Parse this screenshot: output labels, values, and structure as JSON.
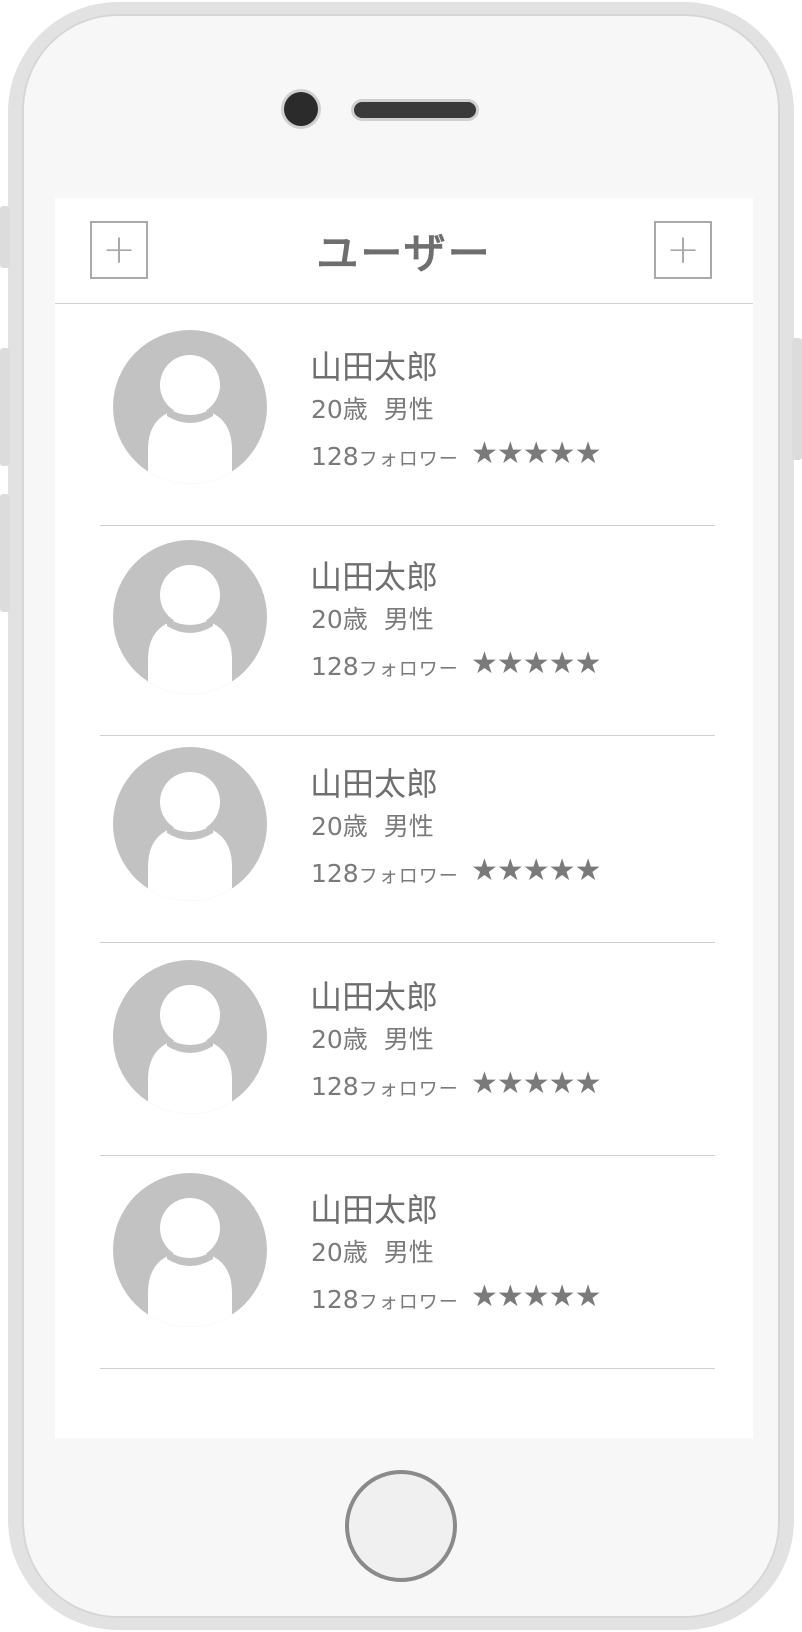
{
  "nav": {
    "title": "ユーザー",
    "left_button_label": "+",
    "right_button_label": "+"
  },
  "users": [
    {
      "name": "山田太郎",
      "meta": "20歳  男性",
      "followers_count": "128",
      "followers_label": "フォロワー",
      "stars": "★★★★★"
    },
    {
      "name": "山田太郎",
      "meta": "20歳  男性",
      "followers_count": "128",
      "followers_label": "フォロワー",
      "stars": "★★★★★"
    },
    {
      "name": "山田太郎",
      "meta": "20歳  男性",
      "followers_count": "128",
      "followers_label": "フォロワー",
      "stars": "★★★★★"
    },
    {
      "name": "山田太郎",
      "meta": "20歳  男性",
      "followers_count": "128",
      "followers_label": "フォロワー",
      "stars": "★★★★★"
    },
    {
      "name": "山田太郎",
      "meta": "20歳  男性",
      "followers_count": "128",
      "followers_label": "フォロワー",
      "stars": "★★★★★"
    }
  ],
  "icons": {
    "avatar": "user-avatar-placeholder-icon",
    "add": "plus-icon",
    "star": "star-icon"
  },
  "colors": {
    "text": "#6f6f6f",
    "avatar_fill": "#c2c2c2",
    "divider": "#cfcfcf"
  }
}
